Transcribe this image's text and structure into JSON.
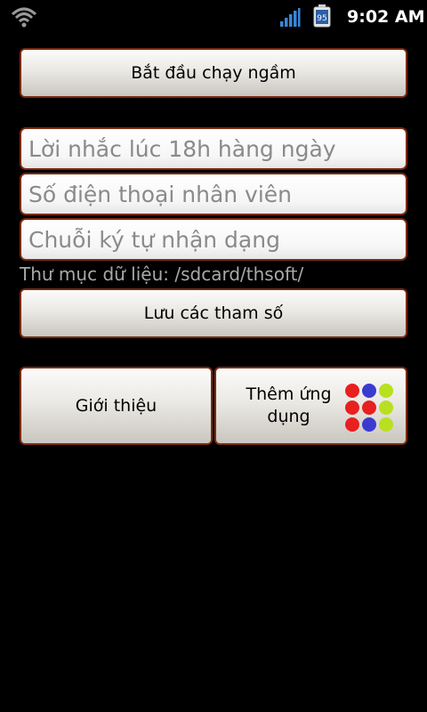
{
  "status_bar": {
    "time": "9:02 AM",
    "battery_level": "95",
    "icons": [
      "wifi-icon",
      "signal-bars-icon",
      "battery-icon"
    ]
  },
  "buttons": {
    "start_background": "Bắt đầu chạy ngầm",
    "save_params": "Lưu các tham số",
    "about": "Giới thiệu",
    "add_app": "Thêm ứng dụng"
  },
  "fields": {
    "reminder_placeholder": "Lời nhắc lúc 18h hàng ngày",
    "phone_placeholder": "Số điện thoại nhân viên",
    "id_string_placeholder": "Chuỗi ký tự nhận dạng"
  },
  "folder_label": "Thư mục dữ liệu: /sdcard/thsoft/",
  "colors": {
    "button_border": "#7a2a10",
    "dot_red": "#e82020",
    "dot_blue": "#3b3bd0",
    "dot_green": "#b8e020"
  }
}
